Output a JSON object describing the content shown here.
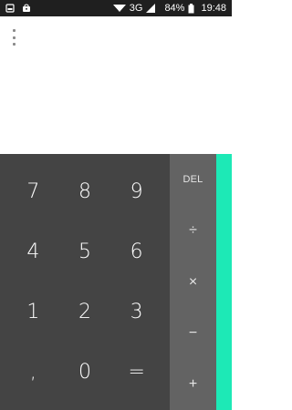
{
  "status_bar": {
    "network": "3G",
    "battery": "84%",
    "time": "19:48",
    "icons": [
      "notification-icon",
      "bag-icon",
      "wifi-icon",
      "signal-icon",
      "battery-icon"
    ]
  },
  "display": {
    "menu_icon": "overflow-menu-icon",
    "expression": ""
  },
  "keypad": {
    "rows": [
      [
        "7",
        "8",
        "9"
      ],
      [
        "4",
        "5",
        "6"
      ],
      [
        "1",
        "2",
        "3"
      ],
      [
        ",",
        "0",
        "="
      ]
    ]
  },
  "operators": {
    "del": "DEL",
    "divide": "÷",
    "multiply": "×",
    "minus": "−",
    "plus": "+"
  },
  "colors": {
    "numpad_bg": "#444444",
    "ops_bg": "#636363",
    "accent": "#1de9b6",
    "status_bg": "#1f1f1f"
  }
}
